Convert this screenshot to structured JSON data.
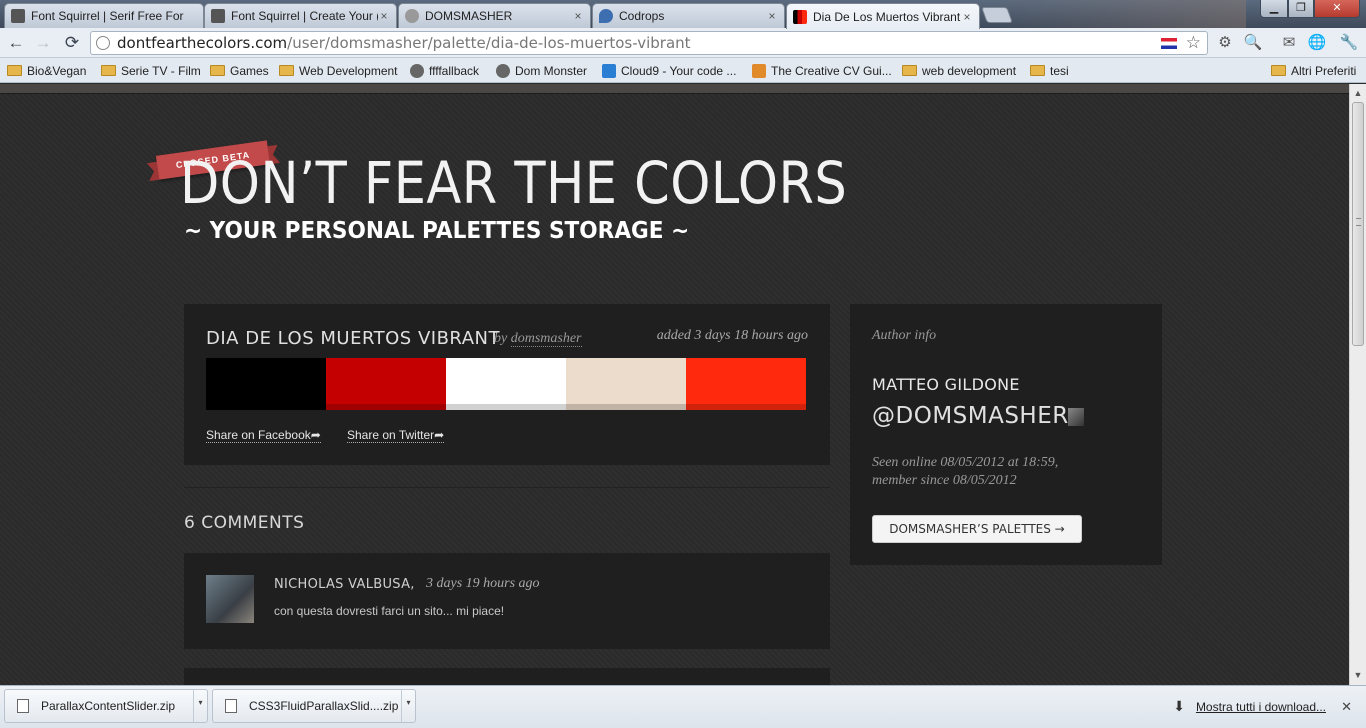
{
  "browser": {
    "tabs": [
      {
        "title": "Font Squirrel | Serif Free For",
        "favicon_color": "#555555"
      },
      {
        "title": "Font Squirrel | Create Your (",
        "favicon_color": "#555555"
      },
      {
        "title": "DOMSMASHER",
        "favicon_color": "#777777"
      },
      {
        "title": "Codrops",
        "favicon_color": "#3d6fb0"
      },
      {
        "title": "Dia De Los Muertos Vibrant",
        "favicon_color": "#c8102e",
        "active": true
      }
    ],
    "tab_close_glyph": "×",
    "window_buttons": {
      "minimize": "▁",
      "maximize": "❐",
      "close": "✕"
    },
    "address": {
      "domain": "dontfearthecolors.com",
      "path": "/user/domsmasher/palette/dia-de-los-muertos-vibrant"
    },
    "nav_glyphs": {
      "back": "←",
      "forward": "→",
      "reload": "⟳",
      "star": "☆",
      "wrench": "🔧"
    },
    "extensions": [
      "⚙",
      "🔍",
      "✉",
      "🌐"
    ],
    "bookmarks": [
      {
        "label": "Bio&Vegan",
        "icon": "folder"
      },
      {
        "label": "Serie TV - Film",
        "icon": "folder"
      },
      {
        "label": "Games",
        "icon": "folder"
      },
      {
        "label": "Web Development",
        "icon": "folder"
      },
      {
        "label": "ffffallback",
        "icon": "site"
      },
      {
        "label": "Dom Monster",
        "icon": "site"
      },
      {
        "label": "Cloud9 - Your code ...",
        "icon": "site"
      },
      {
        "label": "The Creative CV Gui...",
        "icon": "site"
      },
      {
        "label": "web development",
        "icon": "folder"
      },
      {
        "label": "tesi",
        "icon": "folder"
      }
    ],
    "other_bookmarks": "Altri Preferiti"
  },
  "site": {
    "beta_badge": "CLOSED BETA",
    "title": "DON’T FEAR THE COLORS",
    "subtitle": "~ YOUR PERSONAL PALETTES STORAGE ~"
  },
  "palette": {
    "name": "DIA DE LOS MUERTOS VIBRANT",
    "by_label": "by",
    "author": "domsmasher",
    "added": "added 3 days 18 hours ago",
    "colors": [
      "#000000",
      "#c40000",
      "#ffffff",
      "#ecdccb",
      "#ff2a0e"
    ],
    "share_facebook": "Share on Facebook",
    "share_twitter": "Share on Twitter",
    "share_arrow": "➦"
  },
  "comments": {
    "heading": "6 COMMENTS",
    "items": [
      {
        "author": "NICHOLAS VALBUSA,",
        "time": "3 days 19 hours ago",
        "text": "con questa dovresti farci un sito... mi piace!"
      }
    ]
  },
  "author_info": {
    "heading": "Author info",
    "name": "MATTEO GILDONE",
    "handle": "@DOMSMASHER",
    "seen_line1": "Seen online 08/05/2012 at 18:59,",
    "seen_line2": "member since 08/05/2012",
    "palettes_button": "DOMSMASHER’S PALETTES →"
  },
  "downloads": {
    "items": [
      {
        "name": "ParallaxContentSlider.zip"
      },
      {
        "name": "CSS3FluidParallaxSlid....zip"
      }
    ],
    "caret": "▾",
    "show_all": "Mostra tutti i download...",
    "show_all_icon": "⬇",
    "close": "✕"
  },
  "scrollbar": {
    "up": "▲",
    "down": "▼"
  }
}
